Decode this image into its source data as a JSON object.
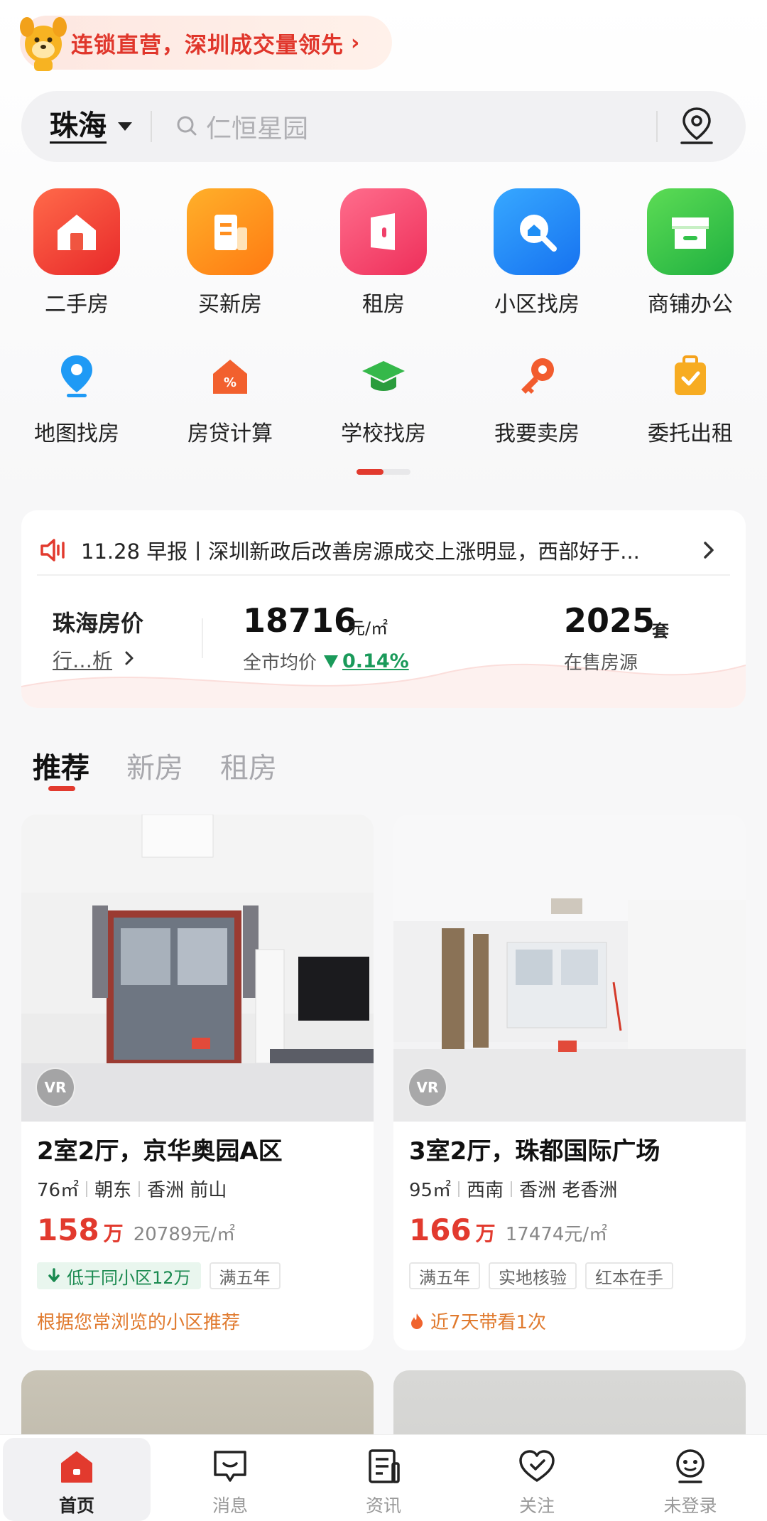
{
  "promo": {
    "text": "连锁直营，深圳成交量领先",
    "arrow": "›"
  },
  "search": {
    "city": "珠海",
    "placeholder": "仁恒星园"
  },
  "main_grid": [
    {
      "label": "二手房",
      "icon": "house-icon",
      "color": "#f24a3a"
    },
    {
      "label": "买新房",
      "icon": "building-icon",
      "color": "#ff8f1f"
    },
    {
      "label": "租房",
      "icon": "door-icon",
      "color": "#f53d6b"
    },
    {
      "label": "小区找房",
      "icon": "magnifier-house-icon",
      "color": "#1f8ff5"
    },
    {
      "label": "商铺办公",
      "icon": "shop-icon",
      "color": "#33c24a"
    }
  ],
  "sub_grid": [
    {
      "label": "地图找房",
      "icon": "map-pin-icon"
    },
    {
      "label": "房贷计算",
      "icon": "percent-house-icon"
    },
    {
      "label": "学校找房",
      "icon": "graduation-cap-icon"
    },
    {
      "label": "我要卖房",
      "icon": "key-icon"
    },
    {
      "label": "委托出租",
      "icon": "suitcase-icon"
    }
  ],
  "market": {
    "news": "11.28 早报丨深圳新政后改善房源成交上涨明显，西部好于...",
    "city_title": "珠海房价",
    "analysis_link": "行…析",
    "avg_price": "18716",
    "avg_unit": "元/㎡",
    "avg_label": "全市均价",
    "change_pct": "0.14%",
    "count": "2025",
    "count_unit": "套",
    "count_label": "在售房源"
  },
  "tabs": [
    "推荐",
    "新房",
    "租房"
  ],
  "listings": [
    {
      "title": "2室2厅，京华奥园A区",
      "area": "76㎡",
      "orientation": "朝东",
      "district": "香洲 前山",
      "price": "158",
      "price_unit": "万",
      "unit_price": "20789元/㎡",
      "tags": [
        "低于同小区12万",
        "满五年"
      ],
      "reason": "根据您常浏览的小区推荐",
      "vr": "VR"
    },
    {
      "title": "3室2厅，珠都国际广场",
      "area": "95㎡",
      "orientation": "西南",
      "district": "香洲 老香洲",
      "price": "166",
      "price_unit": "万",
      "unit_price": "17474元/㎡",
      "tags": [
        "满五年",
        "实地核验",
        "红本在手"
      ],
      "reason": "近7天带看1次",
      "vr": "VR"
    }
  ],
  "nav": [
    {
      "label": "首页",
      "icon": "home-icon",
      "active": true
    },
    {
      "label": "消息",
      "icon": "message-icon",
      "active": false
    },
    {
      "label": "资讯",
      "icon": "news-icon",
      "active": false
    },
    {
      "label": "关注",
      "icon": "heart-check-icon",
      "active": false
    },
    {
      "label": "未登录",
      "icon": "user-face-icon",
      "active": false
    }
  ],
  "colors": {
    "accent": "#e23a2e",
    "green": "#1a9a5a",
    "orange": "#e07a2e"
  }
}
